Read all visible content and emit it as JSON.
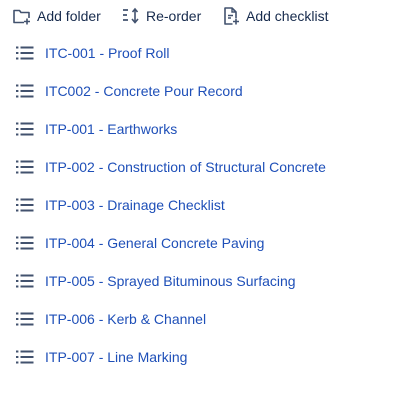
{
  "toolbar": {
    "add_folder": {
      "label": "Add folder",
      "icon": "folder-plus-icon"
    },
    "reorder": {
      "label": "Re-order",
      "icon": "sort-icon"
    },
    "add_checklist": {
      "label": "Add checklist",
      "icon": "file-plus-icon"
    }
  },
  "list": {
    "icon": "list-icon",
    "items": [
      {
        "label": "ITC-001 - Proof Roll"
      },
      {
        "label": "ITC002 - Concrete Pour Record"
      },
      {
        "label": "ITP-001 - Earthworks"
      },
      {
        "label": "ITP-002 - Construction of Structural Concrete"
      },
      {
        "label": "ITP-003 - Drainage Checklist"
      },
      {
        "label": "ITP-004 - General Concrete Paving"
      },
      {
        "label": "ITP-005 - Sprayed Bituminous Surfacing"
      },
      {
        "label": "ITP-006 - Kerb & Channel"
      },
      {
        "label": "ITP-007 - Line Marking"
      }
    ]
  },
  "colors": {
    "link": "#1e4fb8",
    "icon": "#42526e",
    "toolbar_text": "#172b4d"
  }
}
